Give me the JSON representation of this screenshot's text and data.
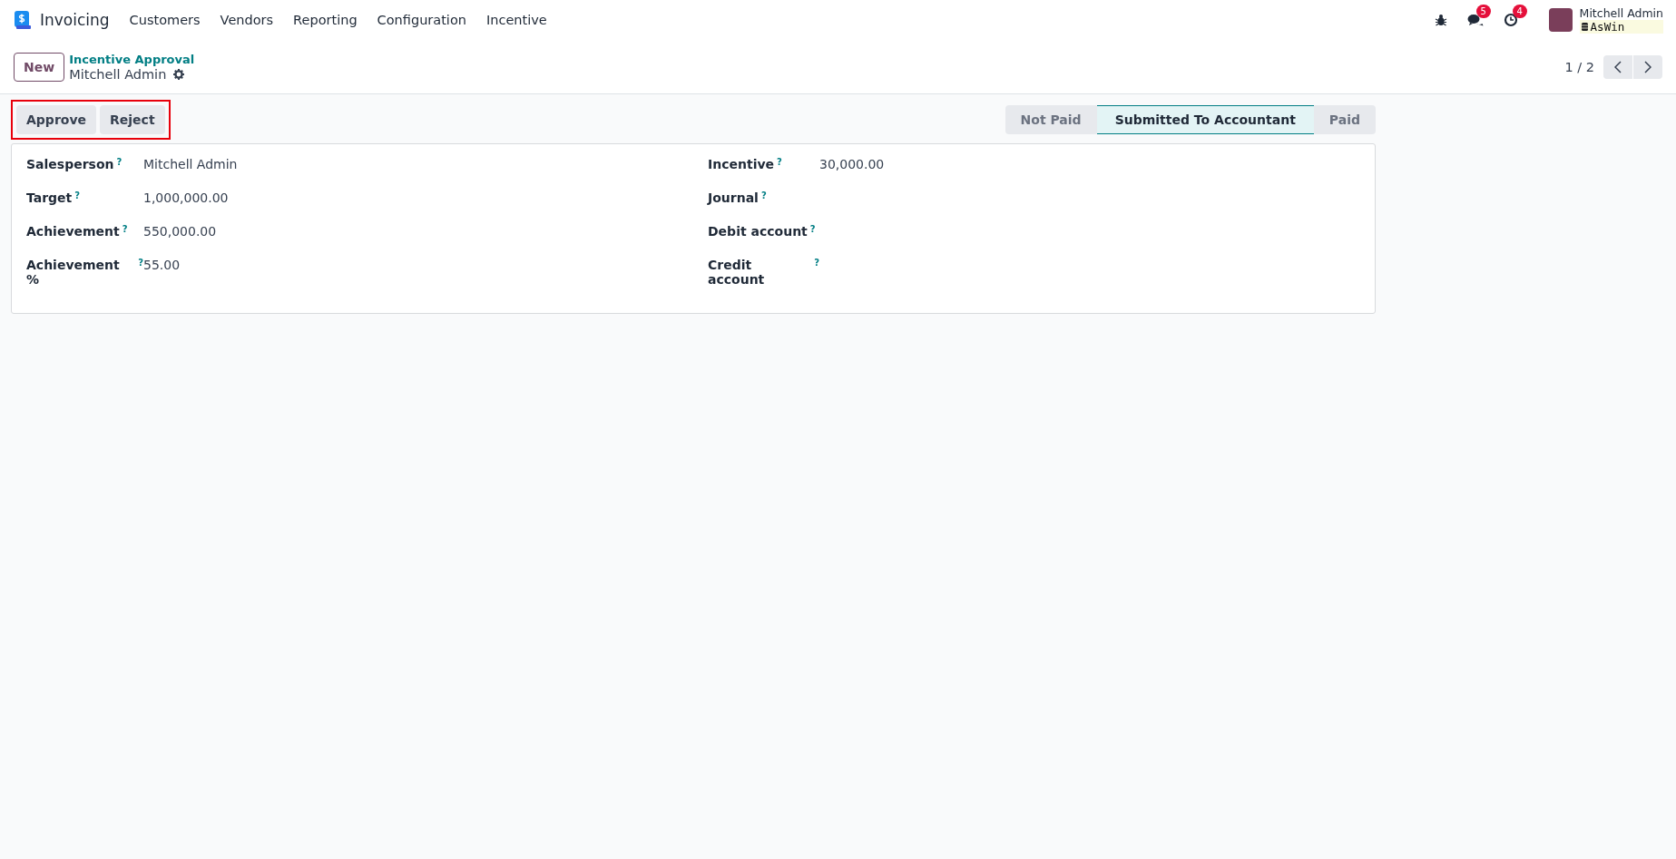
{
  "navbar": {
    "app_name": "Invoicing",
    "menu": [
      {
        "label": "Customers"
      },
      {
        "label": "Vendors"
      },
      {
        "label": "Reporting"
      },
      {
        "label": "Configuration"
      },
      {
        "label": "Incentive"
      }
    ],
    "messages_count": "5",
    "activities_count": "4",
    "user_name": "Mitchell Admin",
    "database": "AsWin"
  },
  "control_panel": {
    "new_button": "New",
    "breadcrumb": "Incentive Approval",
    "record_name": "Mitchell Admin",
    "pager": "1 / 2"
  },
  "actions": {
    "highlighted": true,
    "buttons": [
      {
        "label": "Approve"
      },
      {
        "label": "Reject"
      }
    ]
  },
  "status_bar": [
    {
      "label": "Not Paid",
      "selected": false
    },
    {
      "label": "Submitted To Accountant",
      "selected": true
    },
    {
      "label": "Paid",
      "selected": false
    }
  ],
  "form": {
    "left": [
      {
        "label": "Salesperson",
        "help": "?",
        "value": "Mitchell Admin"
      },
      {
        "label": "Target",
        "help": "?",
        "value": "1,000,000.00"
      },
      {
        "label": "Achievement",
        "help": "?",
        "value": "550,000.00"
      },
      {
        "label": "Achievement %",
        "help": "?",
        "value": "55.00"
      }
    ],
    "right": [
      {
        "label": "Incentive",
        "help": "?",
        "value": "30,000.00"
      },
      {
        "label": "Journal",
        "help": "?"
      },
      {
        "label": "Debit account",
        "help": "?"
      },
      {
        "label": "Credit account",
        "help": "?"
      }
    ]
  }
}
